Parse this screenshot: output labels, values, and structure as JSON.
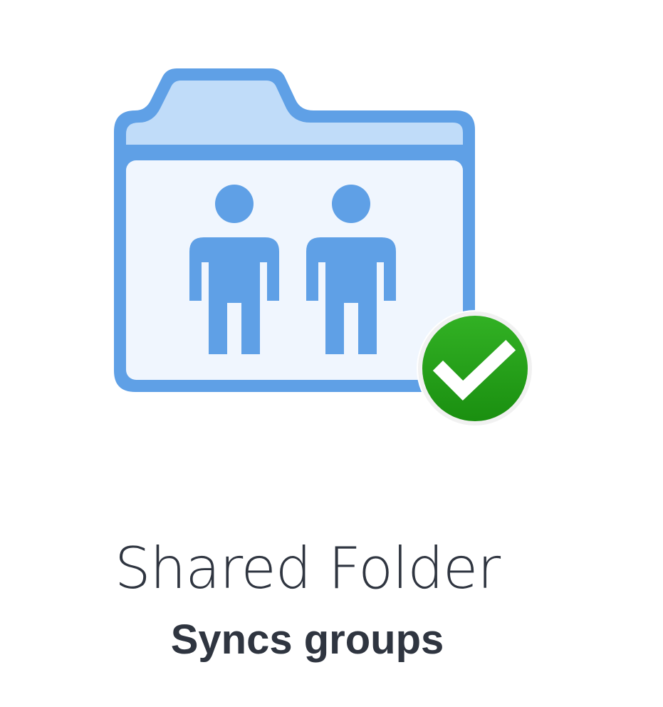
{
  "item": {
    "title": "Shared Folder",
    "subtitle": "Syncs groups",
    "icon": "shared-folder-icon",
    "status_icon": "sync-complete-checkmark-icon"
  },
  "colors": {
    "folder_stroke": "#5fa0e6",
    "folder_tab_fill": "#c0dcf9",
    "folder_body_fill": "#f0f6fe",
    "people_fill": "#5fa0e6",
    "check_badge_fill": "#23a317",
    "check_badge_ring": "#ffffff",
    "check_mark": "#ffffff",
    "text": "#2f3540"
  }
}
